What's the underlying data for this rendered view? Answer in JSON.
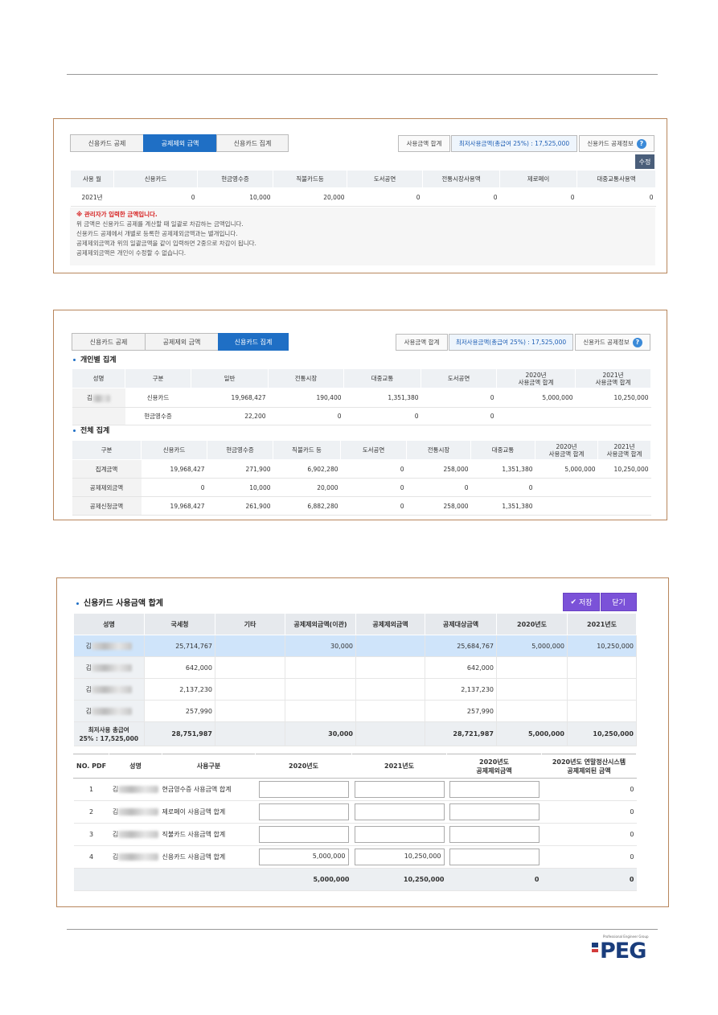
{
  "p1": {
    "tabs": [
      "신용카드 공제",
      "공제제외 금액",
      "신용카드 집계"
    ],
    "btn_sum": "사용금액 합계",
    "btn_min": "최저사용금액(총급여 25%) : 17,525,000",
    "btn_info": "신용카드 공제정보",
    "btn_info_icon": "?",
    "edit": "수정",
    "headers": [
      "사용 월",
      "신용카드",
      "현금영수증",
      "직불카드등",
      "도서공연",
      "전통시장사용액",
      "제로페이",
      "대중교통사용액"
    ],
    "row": [
      "2021년",
      "0",
      "10,000",
      "20,000",
      "0",
      "0",
      "0",
      "0"
    ],
    "note_title": "※ 관리자가 입력한 금액입니다.",
    "notes": [
      "위 금액은 신용카드 공제를 계산할 때 일괄로 차감하는 금액입니다.",
      "신용카드 공제에서 개별로 등록한 공제제외금액과는 별개입니다.",
      "공제제외금액과 위의 일괄금액을 같이 입력하면 2중으로 차감이 됩니다.",
      "공제제외금액은 개인이 수정할 수 없습니다."
    ]
  },
  "p2": {
    "tabs": [
      "신용카드 공제",
      "공제제외 금액",
      "신용카드 집계"
    ],
    "btn_sum": "사용금액 합계",
    "btn_min": "최저사용금액(총급여 25%) : 17,525,000",
    "btn_info": "신용카드 공제정보",
    "btn_info_icon": "?",
    "sec1": "개인별 집계",
    "h1": [
      "성명",
      "구분",
      "일반",
      "전통시장",
      "대중교통",
      "도서공연",
      "2020년\n사용금액 합계",
      "2021년\n사용금액 합계"
    ],
    "r1": [
      "김",
      "신용카드",
      "19,968,427",
      "190,400",
      "1,351,380",
      "0",
      "5,000,000",
      "10,250,000"
    ],
    "r2": [
      "",
      "현금영수증",
      "22,200",
      "0",
      "0",
      "0",
      "",
      ""
    ],
    "sec2": "전체 집계",
    "h2": [
      "구분",
      "신용카드",
      "현금영수증",
      "직불카드 등",
      "도서공연",
      "전통시장",
      "대중교통",
      "2020년\n사용금액 합계",
      "2021년\n사용금액 합계"
    ],
    "rows2": [
      [
        "집계금액",
        "19,968,427",
        "271,900",
        "6,902,280",
        "0",
        "258,000",
        "1,351,380",
        "5,000,000",
        "10,250,000"
      ],
      [
        "공제제외금액",
        "0",
        "10,000",
        "20,000",
        "0",
        "0",
        "0",
        "",
        ""
      ],
      [
        "공제신청금액",
        "19,968,427",
        "261,900",
        "6,882,280",
        "0",
        "258,000",
        "1,351,380",
        "",
        ""
      ]
    ]
  },
  "p3": {
    "title": "신용카드 사용금액 합계",
    "save": "저장",
    "close": "닫기",
    "h": [
      "성명",
      "국세청",
      "기타",
      "공제제외금액(이관)",
      "공제제외금액",
      "공제대상금액",
      "2020년도",
      "2021년도"
    ],
    "rows": [
      [
        "김",
        "25,714,767",
        "",
        "30,000",
        "",
        "25,684,767",
        "5,000,000",
        "10,250,000"
      ],
      [
        "김",
        "642,000",
        "",
        "",
        "",
        "642,000",
        "",
        ""
      ],
      [
        "김",
        "2,137,230",
        "",
        "",
        "",
        "2,137,230",
        "",
        ""
      ],
      [
        "김",
        "257,990",
        "",
        "",
        "",
        "257,990",
        "",
        ""
      ]
    ],
    "total_label": "최저사용 총급여\n25% : 17,525,000",
    "total": [
      "28,751,987",
      "",
      "30,000",
      "",
      "28,721,987",
      "5,000,000",
      "10,250,000"
    ],
    "h2": [
      "NO. PDF",
      "성명",
      "사용구분",
      "2020년도",
      "2021년도",
      "2020년도\n공제제외금액",
      "2020년도 연말정산시스템\n공제제외된 금액"
    ],
    "rows2": [
      [
        "1",
        "김",
        "현금영수증 사용금액 합계",
        "",
        "",
        "",
        "0"
      ],
      [
        "2",
        "김",
        "제로페이 사용금액 합계",
        "",
        "",
        "",
        "0"
      ],
      [
        "3",
        "김",
        "직불카드 사용금액 합계",
        "",
        "",
        "",
        "0"
      ],
      [
        "4",
        "김",
        "신용카드 사용금액 합계",
        "5,000,000",
        "10,250,000",
        "",
        "0"
      ]
    ],
    "sum2": [
      "5,000,000",
      "10,250,000",
      "0",
      "0"
    ]
  },
  "footer": {
    "logo": "PEG",
    "logo_sub": "Professional Engineer Group"
  },
  "colors": {
    "accent": "#1f6fc5",
    "button_purple": "#7b52d8",
    "panel_border": "#b8865c"
  }
}
